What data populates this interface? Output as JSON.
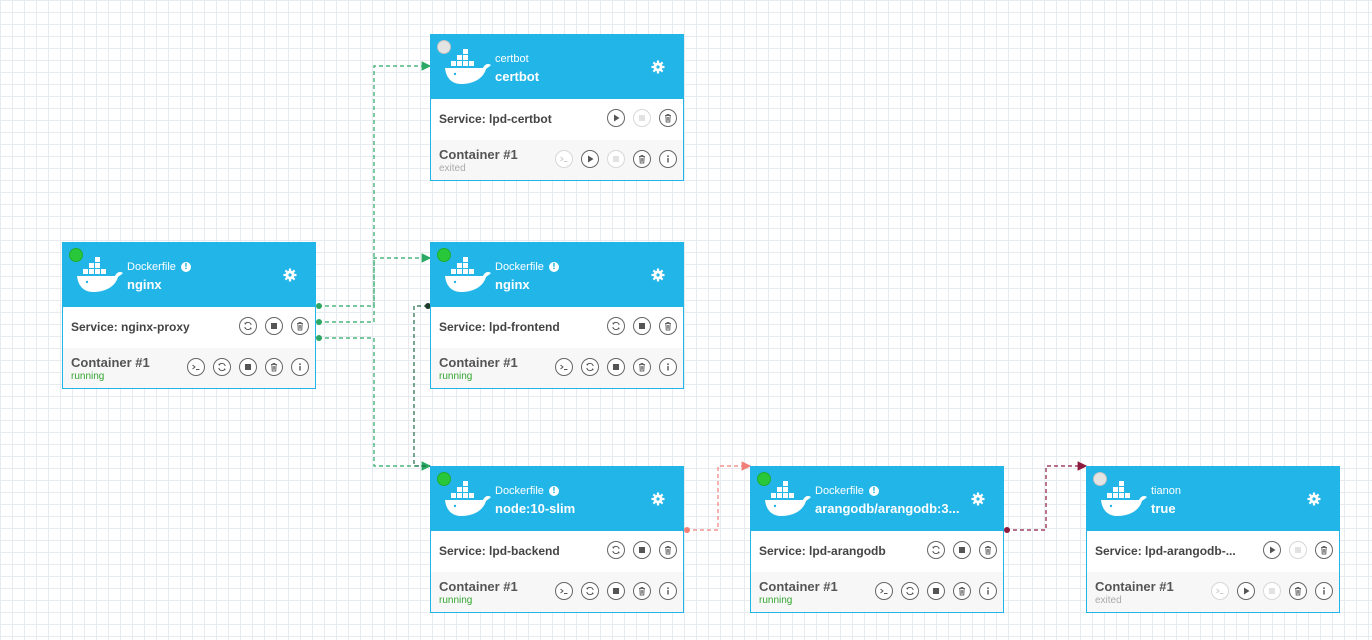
{
  "cards": {
    "certbot": {
      "status": "off",
      "subtitle": "certbot",
      "title": "certbot",
      "service": "Service: lpd-certbot",
      "container_label": "Container #1",
      "container_state": "exited"
    },
    "nginx_proxy": {
      "status": "on",
      "subtitle": "Dockerfile",
      "title": "nginx",
      "service": "Service: nginx-proxy",
      "container_label": "Container #1",
      "container_state": "running"
    },
    "frontend": {
      "status": "on",
      "subtitle": "Dockerfile",
      "title": "nginx",
      "service": "Service: lpd-frontend",
      "container_label": "Container #1",
      "container_state": "running"
    },
    "backend": {
      "status": "on",
      "subtitle": "Dockerfile",
      "title": "node:10-slim",
      "service": "Service: lpd-backend",
      "container_label": "Container #1",
      "container_state": "running"
    },
    "arangodb": {
      "status": "on",
      "subtitle": "Dockerfile",
      "title": "arangodb/arangodb:3...",
      "service": "Service: lpd-arangodb",
      "container_label": "Container #1",
      "container_state": "running"
    },
    "tianon": {
      "status": "off",
      "subtitle": "tianon",
      "title": "true",
      "service": "Service: lpd-arangodb-...",
      "container_label": "Container #1",
      "container_state": "exited"
    }
  },
  "colors": {
    "header": "#22b5e8",
    "running": "#33a532",
    "link_green": "#2aa864",
    "link_salmon": "#f07f78",
    "link_maroon": "#8c1a3c"
  }
}
